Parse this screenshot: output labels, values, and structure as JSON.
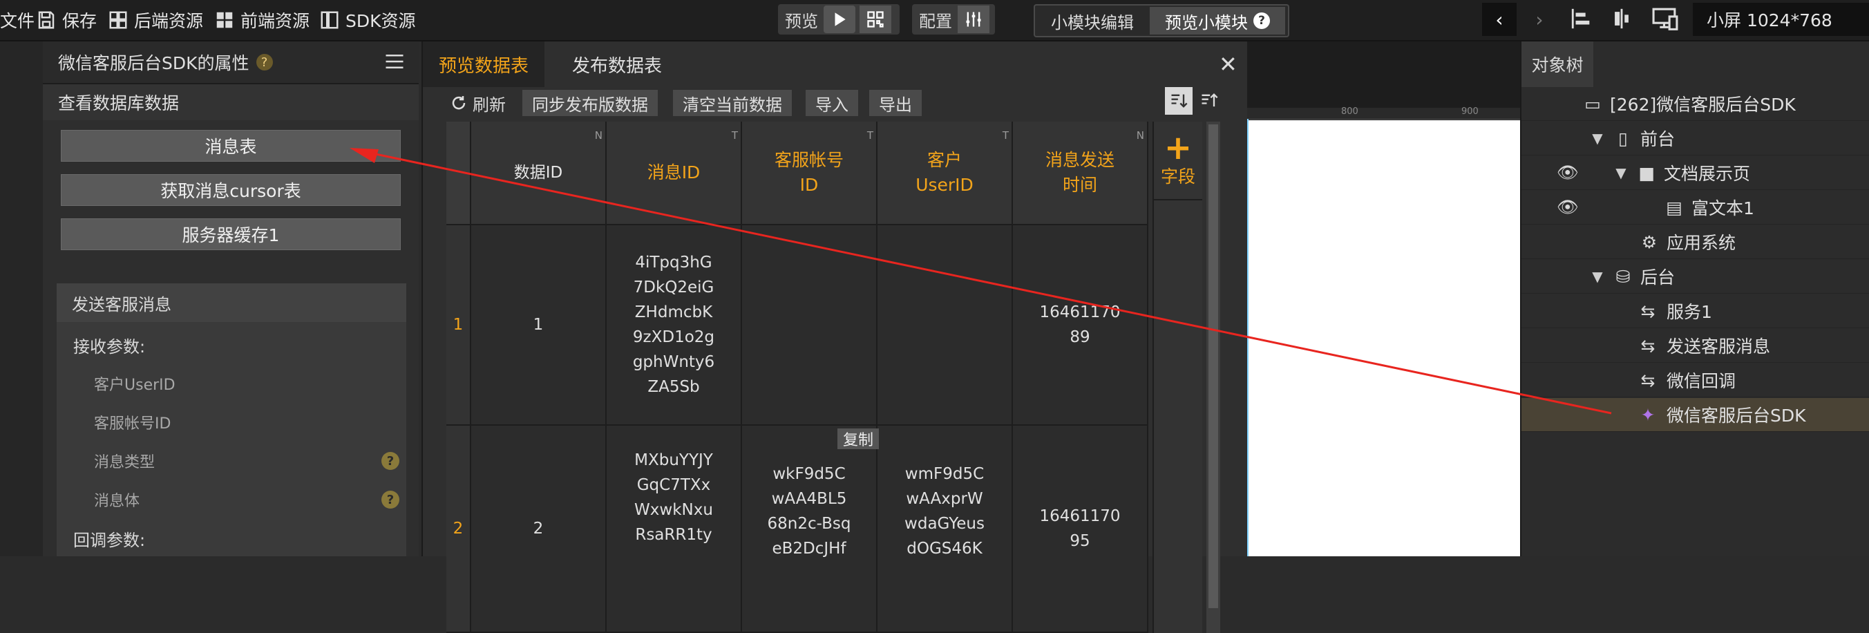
{
  "topbar": {
    "file_label": "文件",
    "save_label": "保存",
    "backend_res": "后端资源",
    "frontend_res": "前端资源",
    "sdk_res": "SDK资源",
    "preview_label": "预览",
    "config_label": "配置",
    "module_edit": "小模块编辑",
    "module_preview": "预览小模块",
    "screen_label": "小屏 1024*768"
  },
  "left_panel": {
    "title": "微信客服后台SDK的属性",
    "section_db": "查看数据库数据",
    "buttons": [
      "消息表",
      "获取消息cursor表",
      "服务器缓存1"
    ],
    "send_section": "发送客服消息",
    "recv_params": "接收参数:",
    "fields": [
      "客户UserID",
      "客服帐号ID",
      "消息类型",
      "消息体"
    ],
    "callback_params": "回调参数:"
  },
  "dialog": {
    "tab_preview": "预览数据表",
    "tab_publish": "发布数据表",
    "refresh": "刷新",
    "sync": "同步发布版数据",
    "clear": "清空当前数据",
    "import": "导入",
    "export": "导出",
    "add_field": "字段",
    "copy_label": "复制",
    "columns": [
      {
        "name": "数据ID",
        "tag": "N"
      },
      {
        "name": "消息ID",
        "tag": "T"
      },
      {
        "name": "客服帐号\nID",
        "tag": "T"
      },
      {
        "name": "客户\nUserID",
        "tag": "T"
      },
      {
        "name": "消息发送\n时间",
        "tag": "N"
      }
    ],
    "rows": [
      {
        "index": "1",
        "cells": [
          "1",
          "4iTpq3hG\n7DkQ2eiG\nZHdmcbK\n9zXD1o2g\ngphWnty6\nZA5Sb",
          "",
          "",
          "16461170\n89"
        ]
      },
      {
        "index": "2",
        "cells": [
          "2",
          "MXbuYYJY\nGqC7TXx\nWxwkNxu\nRsaRR1ty",
          "wkF9d5C\nwAA4BL5\n68n2c-Bsq\neB2DcJHf",
          "wmF9d5C\nwAAxprW\nwdaGYeus\ndOGS46K",
          "16461170\n95"
        ]
      }
    ]
  },
  "ruler": {
    "marks": [
      "800",
      "900"
    ]
  },
  "object_tree": {
    "tab": "对象树",
    "items": [
      {
        "label": "[262]微信客服后台SDK"
      },
      {
        "label": "前台"
      },
      {
        "label": "文档展示页"
      },
      {
        "label": "富文本1"
      },
      {
        "label": "应用系统"
      },
      {
        "label": "后台"
      },
      {
        "label": "服务1"
      },
      {
        "label": "发送客服消息"
      },
      {
        "label": "微信回调"
      },
      {
        "label": "微信客服后台SDK"
      }
    ]
  },
  "colors": {
    "accent": "#f3a41a",
    "arrow": "#e8251f",
    "selected": "#4a4335"
  }
}
